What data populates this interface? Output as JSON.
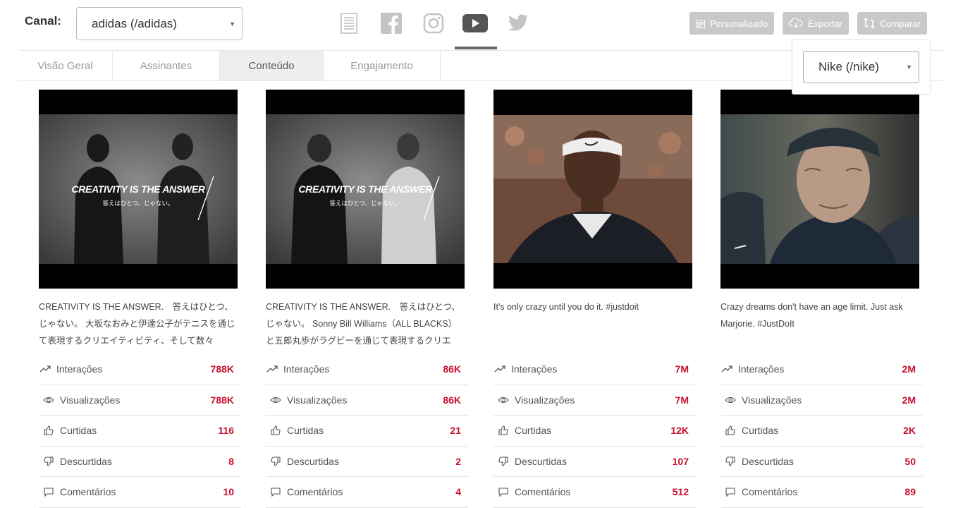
{
  "header": {
    "canal_label": "Canal:",
    "canal_value": "adidas (/adidas)",
    "socials": [
      "document-icon",
      "facebook-icon",
      "instagram-icon",
      "youtube-icon",
      "twitter-icon"
    ],
    "active_social": "youtube-icon",
    "buttons": {
      "personalizado": "Personalizado",
      "exportar": "Exportar",
      "comparar": "Comparar"
    },
    "compare_value": "Nike (/nike)"
  },
  "tabs": [
    {
      "label": "Visão Geral"
    },
    {
      "label": "Assinantes"
    },
    {
      "label": "Conteúdo"
    },
    {
      "label": "Engajamento"
    }
  ],
  "active_tab": "Conteúdo",
  "metric_labels": {
    "interacoes": "Interações",
    "visualizacoes": "Visualizações",
    "curtidas": "Curtidas",
    "descurtidas": "Descurtidas",
    "comentarios": "Comentários"
  },
  "posts": [
    {
      "caption": "CREATIVITY IS THE ANSWER.　答えはひとつ、じゃない。 大坂なおみと伊達公子がテニスを通じて表現するクリエイティビティ、そして数々",
      "overlay_title": "CREATIVITY IS THE ANSWER",
      "overlay_sub": "答えはひとつ、じゃない。",
      "interacoes": "788K",
      "visualizacoes": "788K",
      "curtidas": "116",
      "descurtidas": "8",
      "comentarios": "10"
    },
    {
      "caption": "CREATIVITY IS THE ANSWER.　答えはひとつ、じゃない。 Sonny Bill Williams（ALL BLACKS）と五郎丸歩がラグビーを通じて表現するクリエ",
      "overlay_title": "CREATIVITY IS THE ANSWER",
      "overlay_sub": "答えはひとつ、じゃない。",
      "interacoes": "86K",
      "visualizacoes": "86K",
      "curtidas": "21",
      "descurtidas": "2",
      "comentarios": "4"
    },
    {
      "caption": "It's only crazy until you do it. #justdoit",
      "interacoes": "7M",
      "visualizacoes": "7M",
      "curtidas": "12K",
      "descurtidas": "107",
      "comentarios": "512"
    },
    {
      "caption": "Crazy dreams don't have an age limit. Just ask Marjorie. #JustDoIt",
      "interacoes": "2M",
      "visualizacoes": "2M",
      "curtidas": "2K",
      "descurtidas": "50",
      "comentarios": "89"
    }
  ],
  "colors": {
    "accent_value": "#c8102e",
    "button_bg": "#c9c9c9",
    "active_tab_bg": "#eeeeee"
  }
}
